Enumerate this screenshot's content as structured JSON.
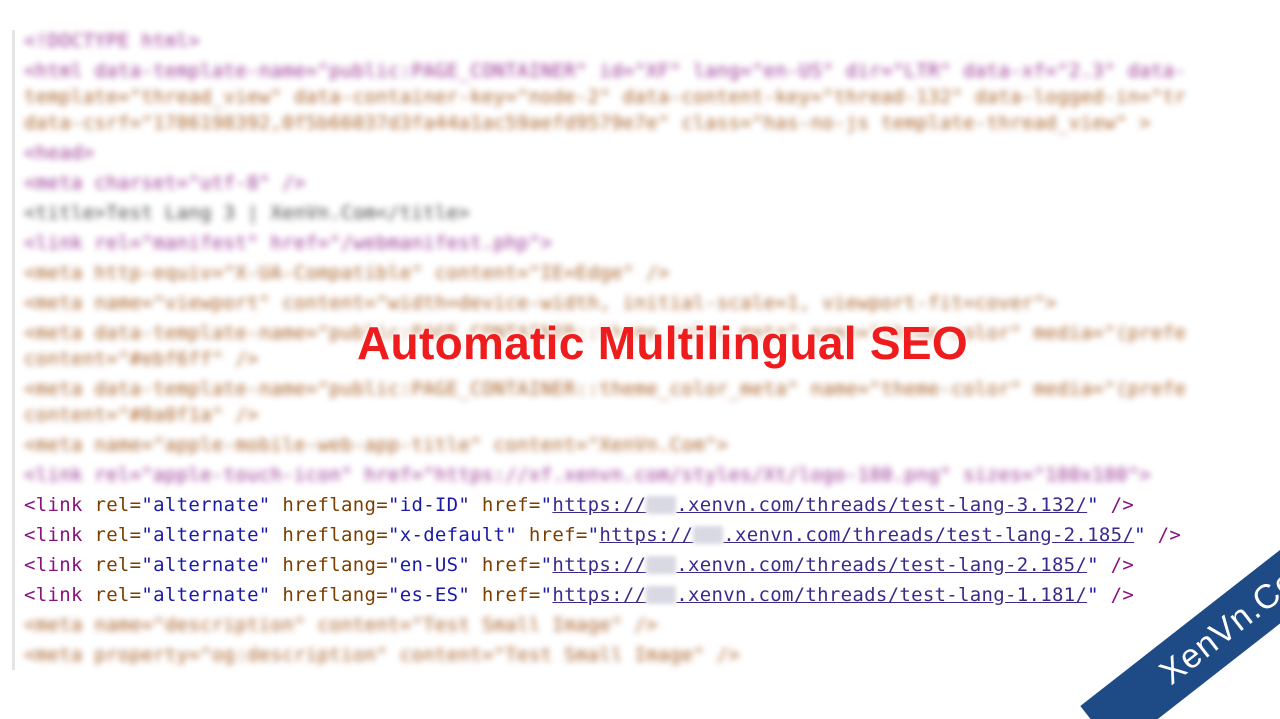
{
  "source_lines": {
    "doctype": "<!DOCTYPE html>",
    "html_open_1": "<html data-template-name=\"public:PAGE_CONTAINER\" id=\"XF\" lang=\"en-US\" dir=\"LTR\" data-xf=\"2.3\" data-",
    "html_open_2": "template=\"thread_view\" data-container-key=\"node-2\" data-content-key=\"thread-132\" data-logged-in=\"tr",
    "html_open_3": "data-csrf=\"1786198392,0f5b66037d3fa44a1ac59aefd9579e7e\" class=\"has-no-js template-thread_view\" >",
    "head_open": "<head>",
    "meta_charset": "<meta charset=\"utf-8\" />",
    "title_line": "<title>Test Lang 3 | XenVn.Com</title>",
    "manifest_link": "<link rel=\"manifest\" href=\"/webmanifest.php\">",
    "meta_compat": "<meta http-equiv=\"X-UA-Compatible\" content=\"IE=Edge\" />",
    "meta_viewport": "<meta name=\"viewport\" content=\"width=device-width, initial-scale=1, viewport-fit=cover\">",
    "meta_theme_1a": "<meta data-template-name=\"public:PAGE_CONTAINER::theme_color_meta\" name=\"theme-color\" media=\"(prefe",
    "meta_theme_1b": "content=\"#ebf6ff\" />",
    "meta_theme_2a": "<meta data-template-name=\"public:PAGE_CONTAINER::theme_color_meta\" name=\"theme-color\" media=\"(prefe",
    "meta_theme_2b": "content=\"#0a0f1a\" />",
    "meta_apple_title": "<meta name=\"apple-mobile-web-app-title\" content=\"XenVn.Com\">",
    "apple_touch_icon": "<link rel=\"apple-touch-icon\" href=\"https://xf.xenvn.com/styles/Xt/logo-180.png\" sizes=\"180x180\">",
    "meta_description": "<meta name=\"description\" content=\"Test Small Image\" />",
    "og_description": "<meta property=\"og:description\" content=\"Test Small Image\" />"
  },
  "hreflang_links": [
    {
      "hreflang": "id-ID",
      "url_prefix": "https://",
      "url_suffix": ".xenvn.com/threads/test-lang-3.132/"
    },
    {
      "hreflang": "x-default",
      "url_prefix": "https://",
      "url_suffix": ".xenvn.com/threads/test-lang-2.185/"
    },
    {
      "hreflang": "en-US",
      "url_prefix": "https://",
      "url_suffix": ".xenvn.com/threads/test-lang-2.185/"
    },
    {
      "hreflang": "es-ES",
      "url_prefix": "https://",
      "url_suffix": ".xenvn.com/threads/test-lang-1.181/"
    }
  ],
  "tokens": {
    "link_open": "<link",
    "rel_attr": "rel=",
    "rel_value": "\"alternate\"",
    "hreflang_attr": "hreflang=",
    "href_attr": "href=",
    "quote": "\"",
    "close": " />"
  },
  "headline": "Automatic Multilingual SEO",
  "watermark": "XenVn.Com",
  "colors": {
    "headline": "#ee1c1c",
    "ribbon": "#1e4b86",
    "tag": "#881280",
    "attribute": "#7a3e00",
    "value": "#1a1aa6"
  }
}
